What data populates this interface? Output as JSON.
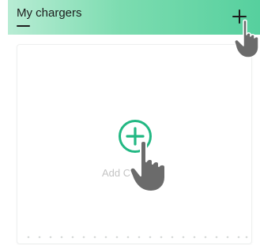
{
  "header": {
    "title": "My chargers",
    "add_icon": "plus-icon"
  },
  "card": {
    "add_label": "Add C",
    "add_icon": "plus-circle-icon"
  },
  "colors": {
    "accent": "#22b883",
    "header_gradient_start": "#b8ecd4",
    "header_gradient_end": "#56d09e",
    "hand": "#6b6b6b"
  },
  "overlays": {
    "pointer_icon": "pointing-hand-icon"
  }
}
